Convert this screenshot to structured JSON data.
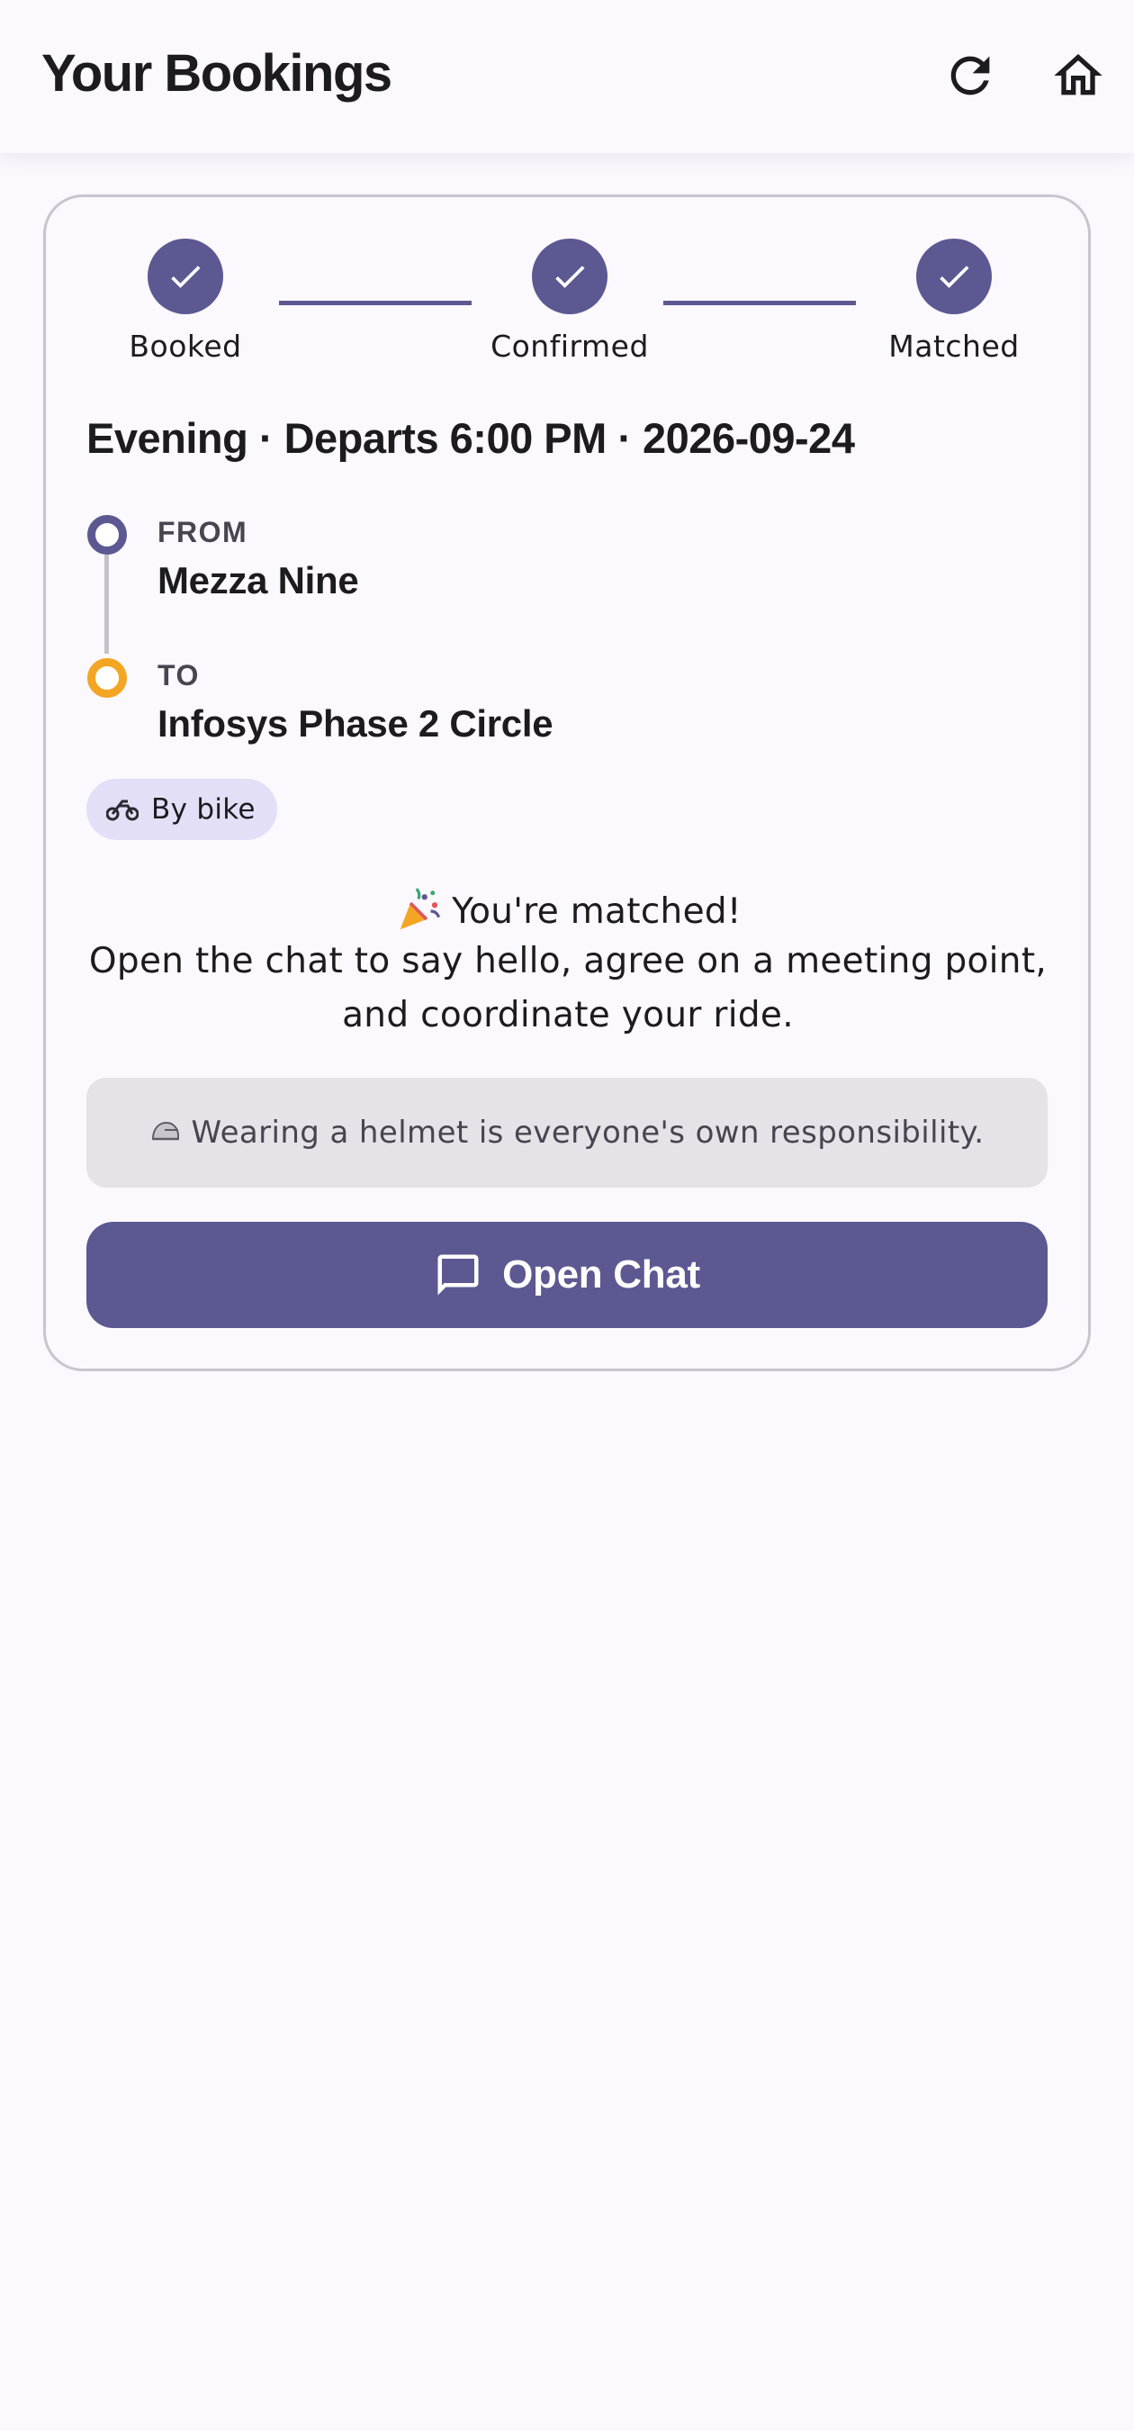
{
  "header": {
    "title": "Your Bookings",
    "refresh_icon": "refresh-icon",
    "home_icon": "home-icon"
  },
  "booking": {
    "stepper": [
      {
        "label": "Booked",
        "done": true
      },
      {
        "label": "Confirmed",
        "done": true
      },
      {
        "label": "Matched",
        "done": true
      }
    ],
    "trip_title": "Evening · Departs 6:00 PM · 2026-09-24",
    "from_label": "FROM",
    "from_value": "Mezza Nine",
    "to_label": "TO",
    "to_value": "Infosys Phase 2 Circle",
    "mode_chip": "By bike",
    "matched_title": "You're matched!",
    "matched_line1": "Open the chat to say hello, agree on a meeting point,",
    "matched_line2": "and coordinate your ride.",
    "helmet_notice": "Wearing a helmet is everyone's own responsibility.",
    "open_chat_label": "Open Chat"
  },
  "colors": {
    "accent": "#5c5891",
    "destination": "#f3a623",
    "chip_bg": "#e3dff6",
    "notice_bg": "#e5e2e8",
    "background": "#fbf8fe"
  }
}
